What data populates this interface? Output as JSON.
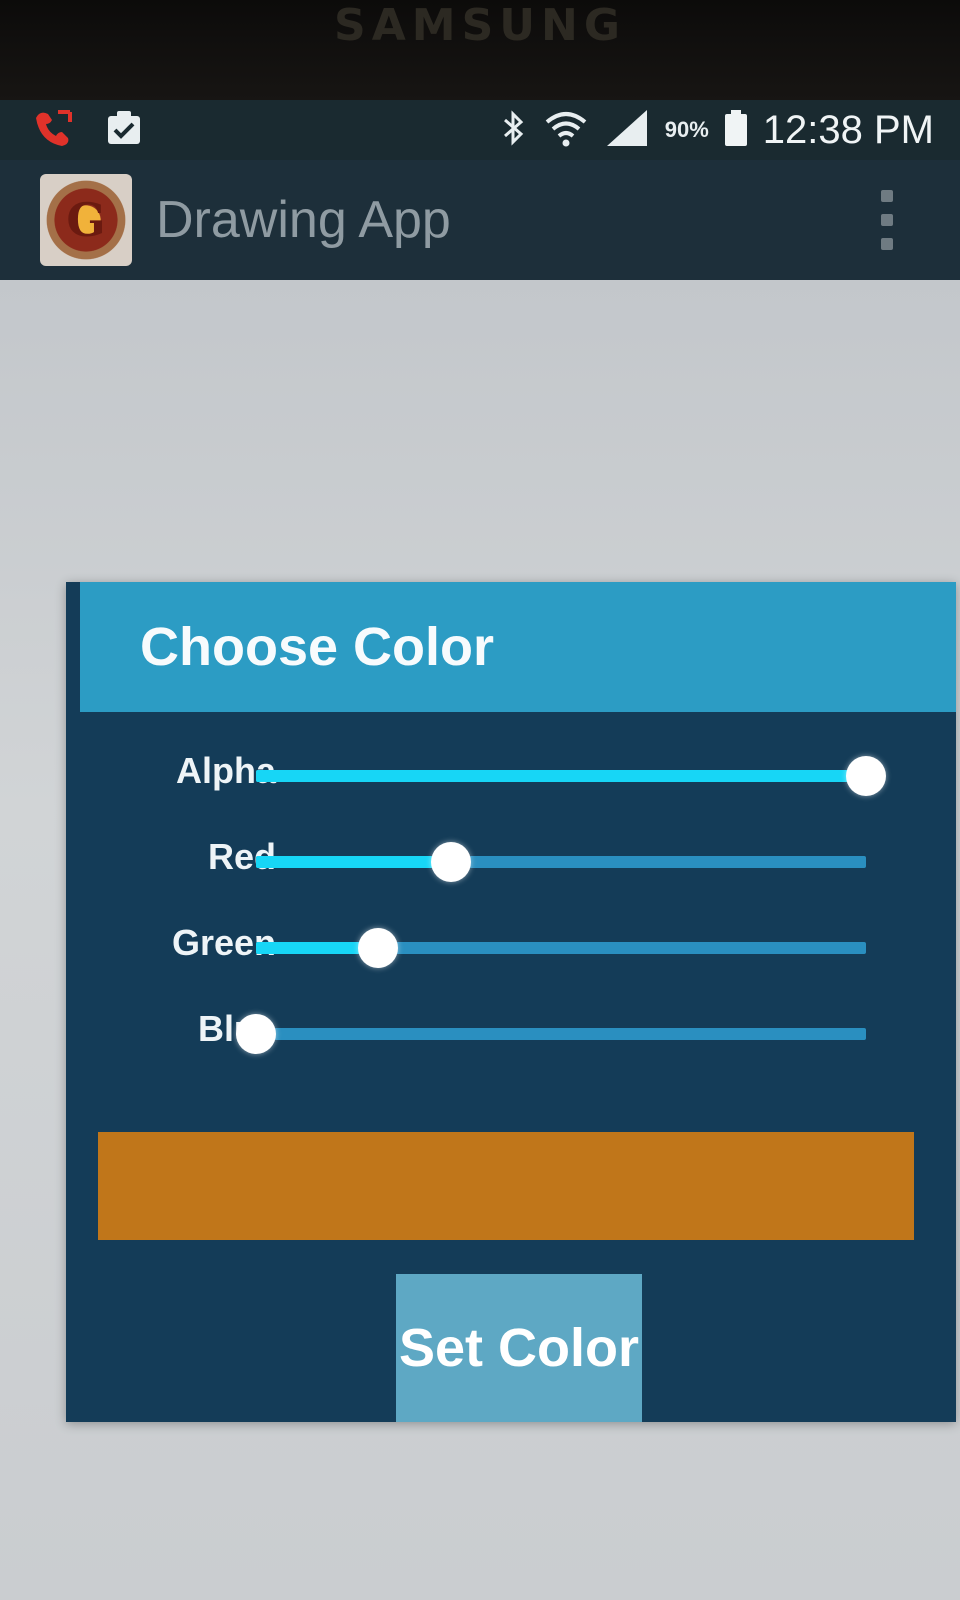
{
  "device": {
    "brand": "SAMSUNG"
  },
  "status_bar": {
    "battery_percent": "90%",
    "time": "12:38 PM",
    "icons": [
      "missed-call-icon",
      "clipboard-check-icon",
      "bluetooth-icon",
      "wifi-icon",
      "signal-icon",
      "battery-icon"
    ]
  },
  "action_bar": {
    "title": "Drawing App",
    "icon_letter": "G"
  },
  "dialog": {
    "title": "Choose Color",
    "sliders": [
      {
        "label": "Alpha",
        "value": 1.0
      },
      {
        "label": "Red",
        "value": 0.32
      },
      {
        "label": "Green",
        "value": 0.2
      },
      {
        "label": "Blue",
        "value": 0.0
      }
    ],
    "preview_color": "#c0761a",
    "set_button": "Set Color"
  },
  "colors": {
    "accent": "#17d6f6",
    "dialog_header": "#2c9cc4",
    "dialog_body": "#143c58"
  }
}
